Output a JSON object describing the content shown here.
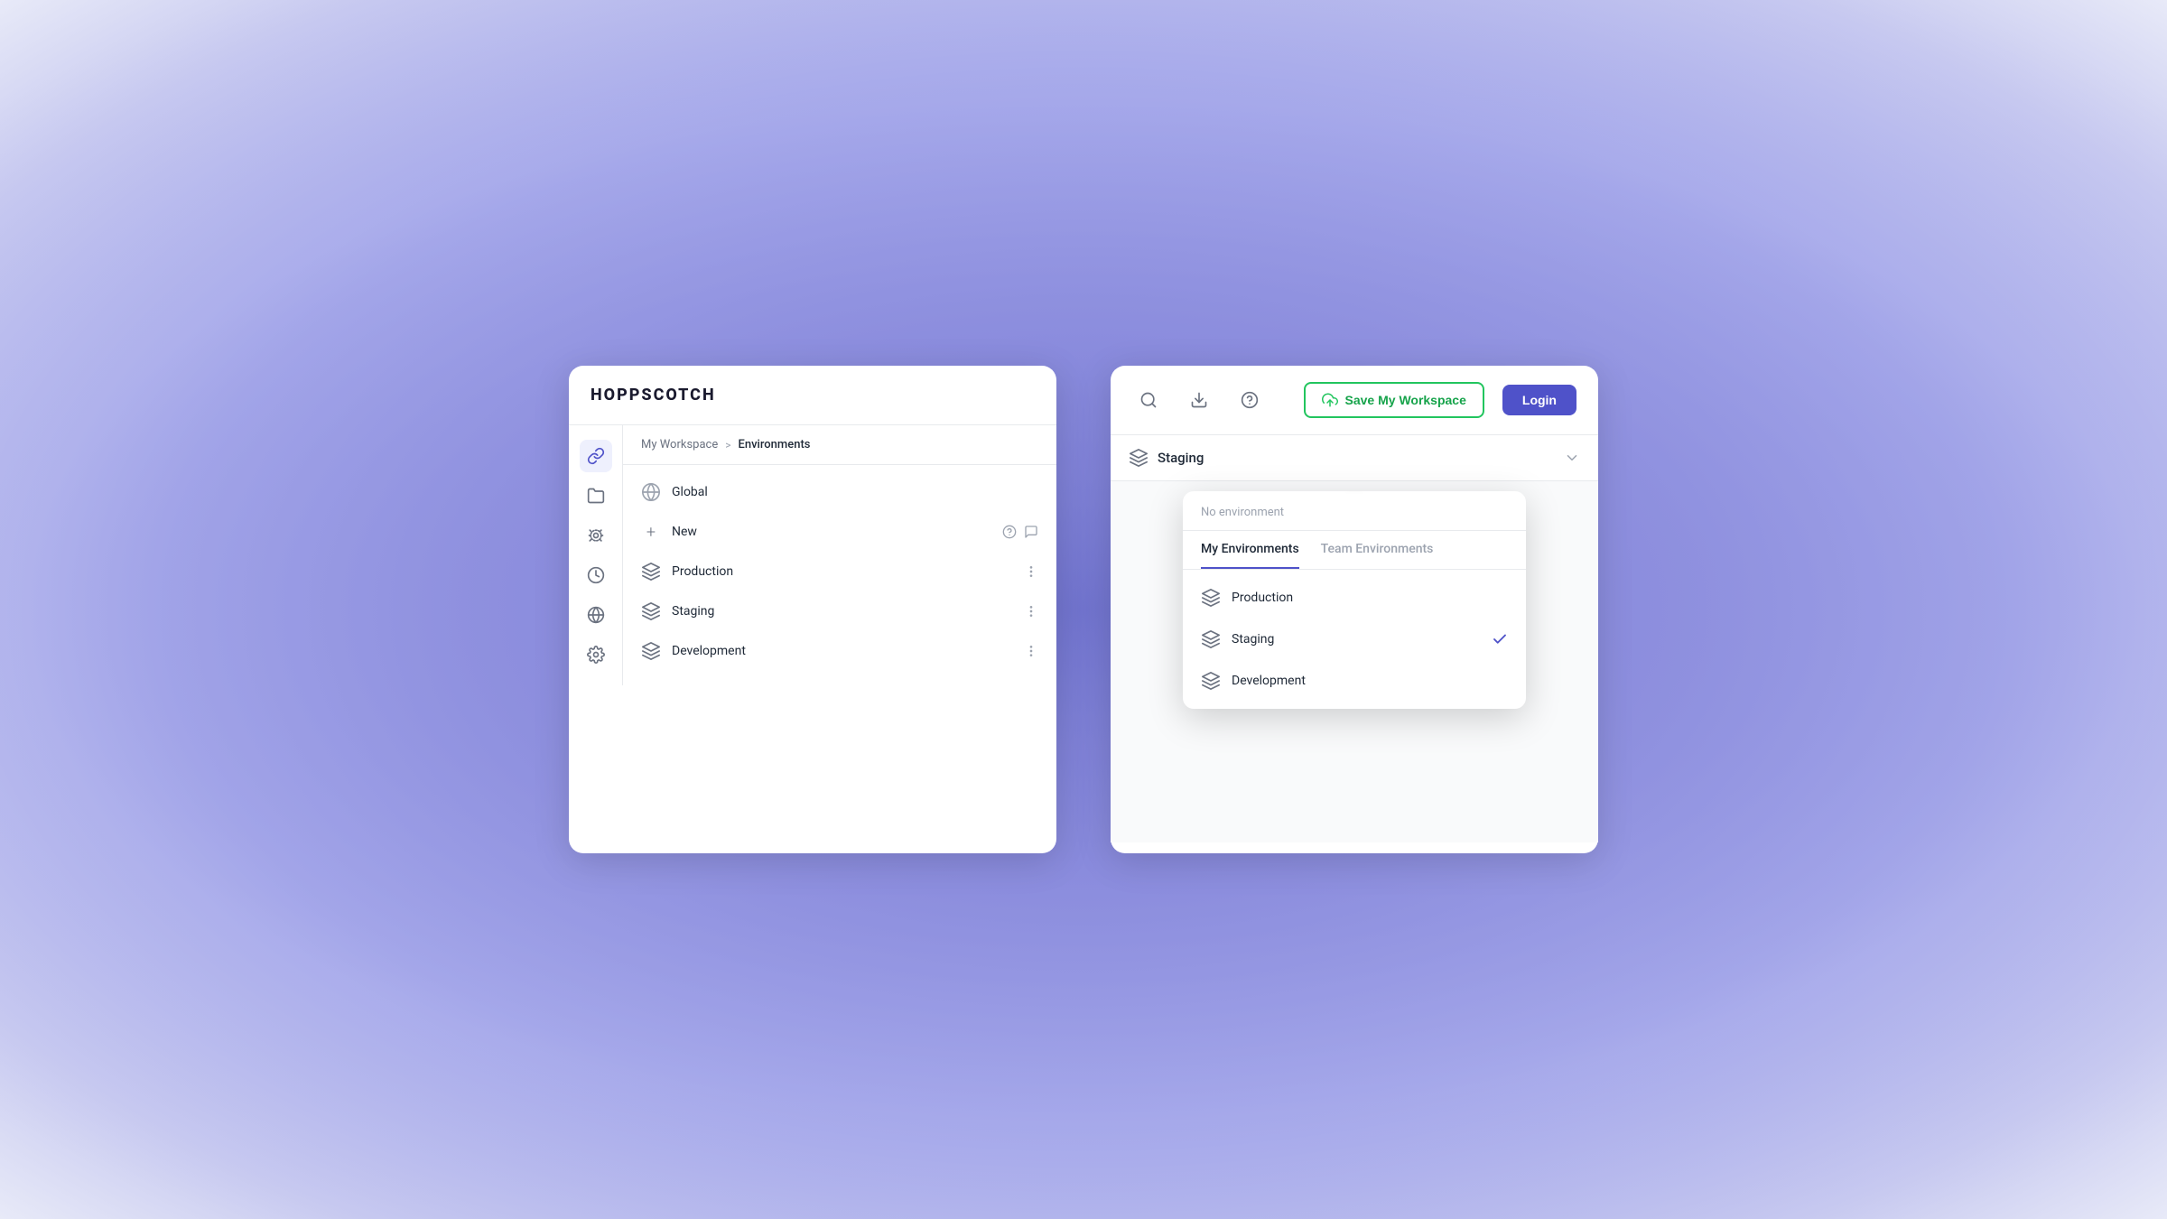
{
  "app": {
    "logo": "HOPPSCOTCH"
  },
  "left_panel": {
    "breadcrumb": {
      "workspace": "My Workspace",
      "separator": ">",
      "current": "Environments"
    },
    "sidebar_icons": [
      {
        "name": "link-icon",
        "active": true
      },
      {
        "name": "folder-icon",
        "active": false
      },
      {
        "name": "settings-icon",
        "active": false
      },
      {
        "name": "history-icon",
        "active": false
      },
      {
        "name": "globe-icon",
        "active": false
      },
      {
        "name": "gear-icon",
        "active": false
      }
    ],
    "env_list": {
      "global_label": "Global",
      "new_label": "New",
      "environments": [
        {
          "name": "Production"
        },
        {
          "name": "Staging"
        },
        {
          "name": "Development"
        }
      ]
    }
  },
  "right_panel": {
    "header": {
      "save_workspace_label": "Save My Workspace",
      "login_label": "Login"
    },
    "env_selector": {
      "selected": "Staging"
    },
    "dropdown": {
      "no_env_label": "No environment",
      "tabs": [
        {
          "label": "My Environments",
          "active": true
        },
        {
          "label": "Team Environments",
          "active": false
        }
      ],
      "environments": [
        {
          "name": "Production",
          "selected": false
        },
        {
          "name": "Staging",
          "selected": true
        },
        {
          "name": "Development",
          "selected": false
        }
      ]
    }
  }
}
